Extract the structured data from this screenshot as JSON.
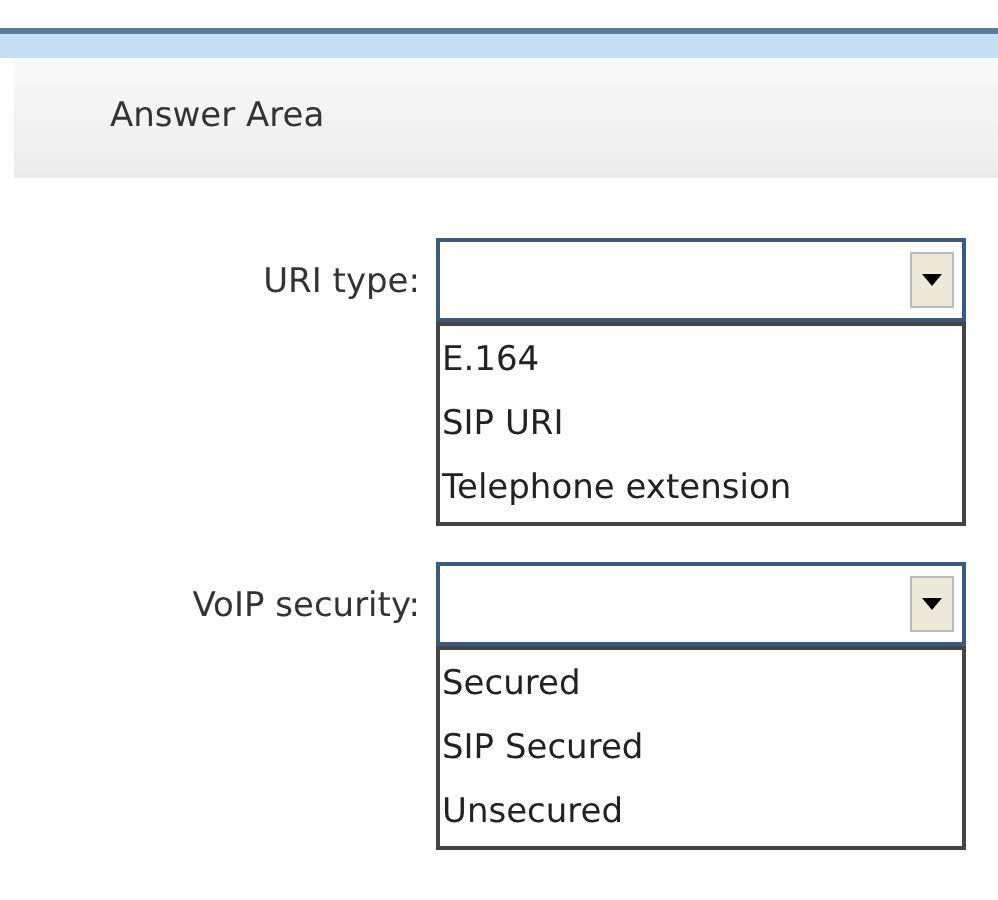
{
  "header": {
    "title": "Answer Area"
  },
  "fields": [
    {
      "label": "URI type:",
      "options": [
        "E.164",
        "SIP URI",
        "Telephone extension"
      ]
    },
    {
      "label": "VoIP security:",
      "options": [
        "Secured",
        "SIP Secured",
        "Unsecured"
      ]
    }
  ]
}
